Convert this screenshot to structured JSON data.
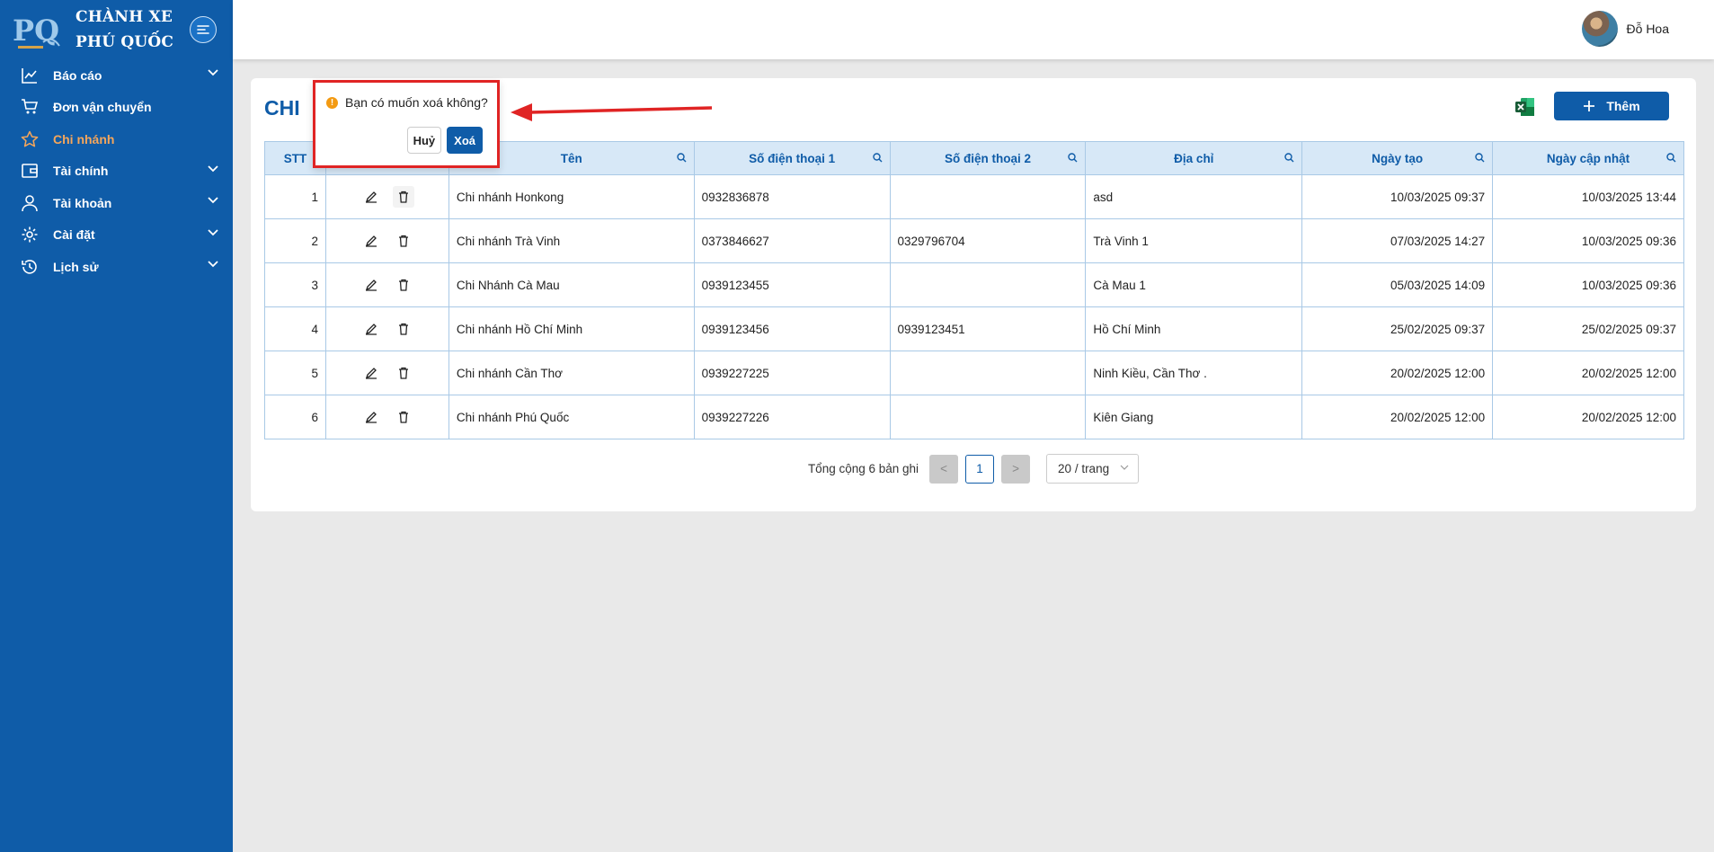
{
  "sidebar": {
    "brand_line1": "CHÀNH XE",
    "brand_line2": "PHÚ QUỐC",
    "logo_text": "PQ",
    "items": [
      {
        "label": "Báo cáo",
        "icon": "chart-line-icon",
        "has_children": true
      },
      {
        "label": "Đơn vận chuyển",
        "icon": "cart-icon",
        "has_children": false
      },
      {
        "label": "Chi nhánh",
        "icon": "star-icon",
        "has_children": false,
        "active": true
      },
      {
        "label": "Tài chính",
        "icon": "wallet-icon",
        "has_children": true
      },
      {
        "label": "Tài khoản",
        "icon": "user-icon",
        "has_children": true
      },
      {
        "label": "Cài đặt",
        "icon": "gear-icon",
        "has_children": true
      },
      {
        "label": "Lịch sử",
        "icon": "history-icon",
        "has_children": true
      }
    ]
  },
  "header": {
    "user_name": "Đỗ Hoa"
  },
  "page": {
    "title": "CHI",
    "add_label": "Thêm"
  },
  "table": {
    "columns": [
      "STT",
      "",
      "Tên",
      "Số điện thoại 1",
      "Số điện thoại 2",
      "Địa chỉ",
      "Ngày tạo",
      "Ngày cập nhật"
    ],
    "rows": [
      {
        "stt": "1",
        "name": "Chi nhánh Honkong",
        "phone1": "0932836878",
        "phone2": "",
        "address": "asd",
        "created": "10/03/2025 09:37",
        "updated": "10/03/2025 13:44"
      },
      {
        "stt": "2",
        "name": "Chi nhánh Trà Vinh",
        "phone1": "0373846627",
        "phone2": "0329796704",
        "address": "Trà Vinh 1",
        "created": "07/03/2025 14:27",
        "updated": "10/03/2025 09:36"
      },
      {
        "stt": "3",
        "name": "Chi Nhánh Cà Mau",
        "phone1": "0939123455",
        "phone2": "",
        "address": "Cà Mau 1",
        "created": "05/03/2025 14:09",
        "updated": "10/03/2025 09:36"
      },
      {
        "stt": "4",
        "name": "Chi nhánh Hồ Chí Minh",
        "phone1": "0939123456",
        "phone2": "0939123451",
        "address": "Hồ Chí Minh",
        "created": "25/02/2025 09:37",
        "updated": "25/02/2025 09:37"
      },
      {
        "stt": "5",
        "name": "Chi nhánh Cần Thơ",
        "phone1": "0939227225",
        "phone2": "",
        "address": "Ninh Kiều, Cần Thơ .",
        "created": "20/02/2025 12:00",
        "updated": "20/02/2025 12:00"
      },
      {
        "stt": "6",
        "name": "Chi nhánh Phú Quốc",
        "phone1": "0939227226",
        "phone2": "",
        "address": "Kiên Giang",
        "created": "20/02/2025 12:00",
        "updated": "20/02/2025 12:00"
      }
    ]
  },
  "pagination": {
    "total_text": "Tổng cộng 6 bản ghi",
    "current_page": "1",
    "page_size": "20 / trang",
    "prev": "<",
    "next": ">"
  },
  "popconfirm": {
    "message": "Bạn có muốn xoá không?",
    "cancel": "Huỷ",
    "ok": "Xoá",
    "icon_glyph": "!"
  },
  "colors": {
    "primary": "#0f5ca8",
    "active": "#f5a65b",
    "warning": "#f39a12",
    "highlight": "#e02424"
  }
}
